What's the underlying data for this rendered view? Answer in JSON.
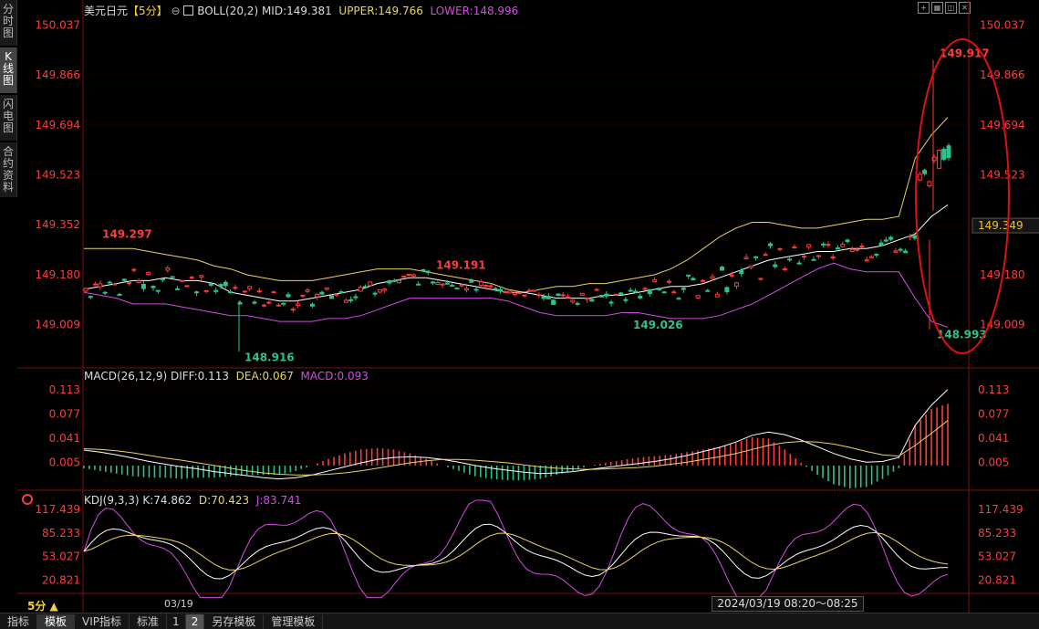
{
  "side_tabs": [
    {
      "label": "分时图"
    },
    {
      "label": "K线图"
    },
    {
      "label": "闪电图"
    },
    {
      "label": "合约资料"
    }
  ],
  "header": {
    "symbol": "美元日元",
    "period": "【5分】",
    "boll_label": "BOLL(20,2)",
    "mid": "MID:149.381",
    "upper": "UPPER:149.766",
    "lower": "LOWER:148.996"
  },
  "macd_header": {
    "name": "MACD(26,12,9)",
    "diff": "DIFF:0.113",
    "dea": "DEA:0.067",
    "macd": "MACD:0.093"
  },
  "kdj_header": {
    "name": "KDJ(9,3,3)",
    "k": "K:74.862",
    "d": "D:70.423",
    "j": "J:83.741"
  },
  "bottom_bar": {
    "period": "5分 ▲",
    "date_label": "03/19",
    "time_range": "2024/03/19 08:20～08:25 二",
    "tabs": [
      "指标",
      "模板",
      "VIP指标",
      "标准",
      "1",
      "2",
      "另存模板",
      "管理模板"
    ]
  },
  "colors": {
    "up": "#ff3b3b",
    "down": "#2ec28b",
    "upper": "#e8d463",
    "mid": "#ffffff",
    "lower": "#d24de0",
    "axis": "#ff3b3b",
    "price_tag_bg": "#e0c000"
  },
  "chart_data": [
    {
      "type": "candlestick",
      "title": "美元日元",
      "yticks": [
        150.037,
        149.866,
        149.694,
        149.523,
        149.352,
        149.18,
        149.009
      ],
      "ylim": [
        148.87,
        150.06
      ],
      "last_price": 149.349,
      "annotations": [
        149.917,
        149.297,
        149.191,
        148.916,
        149.026,
        148.993
      ],
      "mid_band": [
        149.13,
        149.14,
        149.15,
        149.16,
        149.16,
        149.17,
        149.16,
        149.16,
        149.15,
        149.12,
        149.11,
        149.1,
        149.09,
        149.09,
        149.1,
        149.11,
        149.12,
        149.13,
        149.15,
        149.16,
        149.17,
        149.17,
        149.16,
        149.15,
        149.14,
        149.13,
        149.12,
        149.12,
        149.11,
        149.1,
        149.1,
        149.1,
        149.11,
        149.11,
        149.12,
        149.13,
        149.14,
        149.14,
        149.15,
        149.17,
        149.19,
        149.21,
        149.23,
        149.24,
        149.25,
        149.26,
        149.26,
        149.27,
        149.27,
        149.28,
        149.3,
        149.32,
        149.38,
        149.42
      ],
      "upper_band": [
        149.27,
        149.27,
        149.27,
        149.27,
        149.26,
        149.25,
        149.24,
        149.23,
        149.21,
        149.2,
        149.18,
        149.17,
        149.16,
        149.16,
        149.16,
        149.17,
        149.18,
        149.19,
        149.2,
        149.2,
        149.2,
        149.19,
        149.18,
        149.17,
        149.16,
        149.15,
        149.13,
        149.12,
        149.13,
        149.14,
        149.14,
        149.15,
        149.15,
        149.16,
        149.17,
        149.18,
        149.2,
        149.23,
        149.27,
        149.31,
        149.34,
        149.36,
        149.36,
        149.35,
        149.34,
        149.34,
        149.35,
        149.36,
        149.37,
        149.37,
        149.38,
        149.58,
        149.66,
        149.72
      ],
      "lower_band": [
        149.12,
        149.11,
        149.1,
        149.08,
        149.08,
        149.08,
        149.07,
        149.06,
        149.05,
        149.04,
        149.04,
        149.03,
        149.02,
        149.02,
        149.02,
        149.03,
        149.03,
        149.04,
        149.06,
        149.08,
        149.1,
        149.1,
        149.1,
        149.1,
        149.1,
        149.1,
        149.09,
        149.07,
        149.05,
        149.04,
        149.04,
        149.04,
        149.04,
        149.05,
        149.05,
        149.04,
        149.03,
        149.03,
        149.03,
        149.04,
        149.06,
        149.08,
        149.11,
        149.14,
        149.17,
        149.2,
        149.22,
        149.2,
        149.19,
        149.19,
        149.19,
        149.1,
        149.02,
        149.0
      ],
      "macd_yticks": [
        0.113,
        0.077,
        0.041,
        0.005
      ],
      "macd_ylim": [
        -0.03,
        0.125
      ],
      "diff": [
        0.023,
        0.02,
        0.016,
        0.011,
        0.006,
        0.002,
        -0.002,
        -0.005,
        -0.009,
        -0.012,
        -0.015,
        -0.018,
        -0.02,
        -0.018,
        -0.014,
        -0.008,
        -0.002,
        0.004,
        0.009,
        0.012,
        0.013,
        0.012,
        0.009,
        0.005,
        0.0,
        -0.004,
        -0.007,
        -0.01,
        -0.012,
        -0.011,
        -0.009,
        -0.006,
        -0.003,
        0.0,
        0.003,
        0.006,
        0.01,
        0.015,
        0.021,
        0.027,
        0.035,
        0.045,
        0.05,
        0.046,
        0.038,
        0.028,
        0.018,
        0.01,
        0.005,
        0.006,
        0.012,
        0.06,
        0.09,
        0.113
      ],
      "dea": [
        0.025,
        0.024,
        0.022,
        0.019,
        0.015,
        0.011,
        0.008,
        0.004,
        0.0,
        -0.004,
        -0.008,
        -0.011,
        -0.013,
        -0.014,
        -0.014,
        -0.013,
        -0.011,
        -0.008,
        -0.004,
        0.0,
        0.004,
        0.007,
        0.009,
        0.009,
        0.008,
        0.006,
        0.004,
        0.001,
        -0.002,
        -0.004,
        -0.005,
        -0.006,
        -0.005,
        -0.004,
        -0.003,
        -0.001,
        0.002,
        0.005,
        0.009,
        0.013,
        0.018,
        0.024,
        0.03,
        0.034,
        0.036,
        0.035,
        0.032,
        0.027,
        0.021,
        0.016,
        0.014,
        0.03,
        0.048,
        0.067
      ]
    }
  ]
}
